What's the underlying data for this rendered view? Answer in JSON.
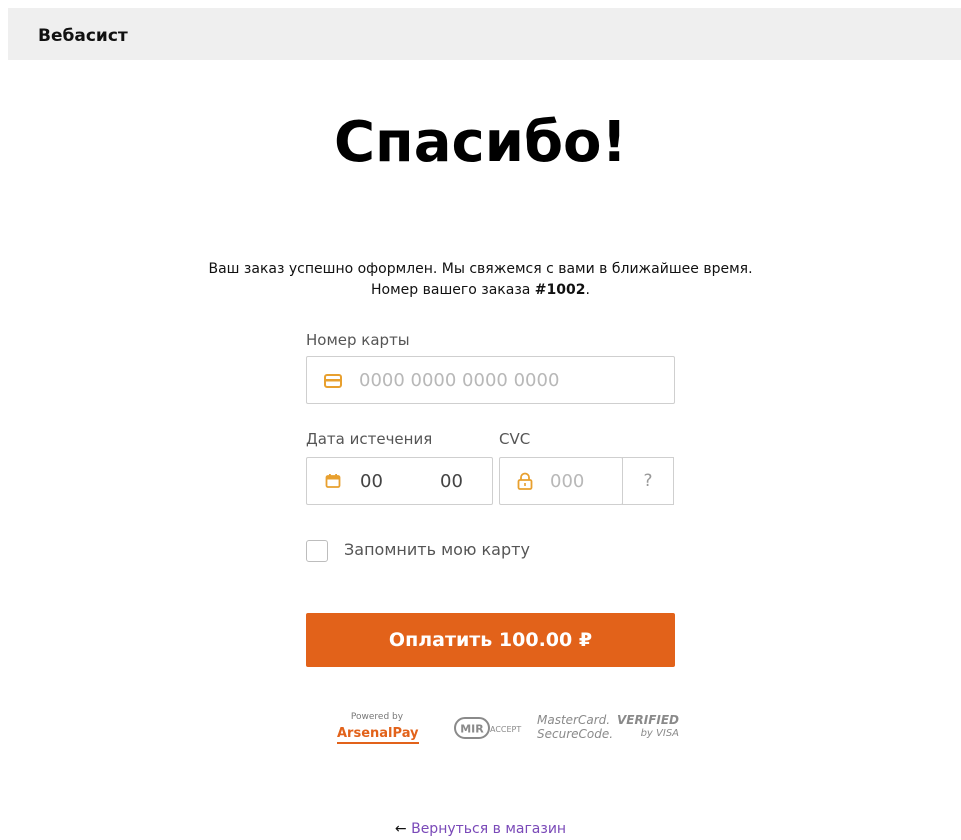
{
  "header": {
    "brand": "Вебасист"
  },
  "main": {
    "title": "Спасибо!",
    "message_line1": "Ваш заказ успешно оформлен. Мы свяжемся с вами в ближайшее время.",
    "message_line2_prefix": "Номер вашего заказа",
    "order_number": "#1002",
    "message_line2_suffix": "."
  },
  "payment_form": {
    "card_number": {
      "label": "Номер карты",
      "placeholder": "0000 0000 0000 0000"
    },
    "expiry": {
      "label": "Дата истечения",
      "month": "00",
      "year": "00"
    },
    "cvc": {
      "label": "CVC",
      "placeholder": "000",
      "help": "?"
    },
    "remember_card": {
      "label": "Запомнить мою карту",
      "checked": false
    },
    "pay_button": "Оплатить 100.00 ₽"
  },
  "logos": {
    "powered_by": "Powered by",
    "arsenalpay": "ArsenalPay",
    "mir_left": "MIR",
    "mir_right": "ACCEPT",
    "mastercard_line1": "MasterCard.",
    "mastercard_line2": "SecureCode.",
    "visa_line1": "VERIFIED",
    "visa_line2": "by VISA"
  },
  "footer": {
    "arrow": "←",
    "back_link": "Вернуться в магазин"
  },
  "colors": {
    "accent": "#e2621a",
    "link": "#7a49b8",
    "header_bg": "#efefef"
  }
}
